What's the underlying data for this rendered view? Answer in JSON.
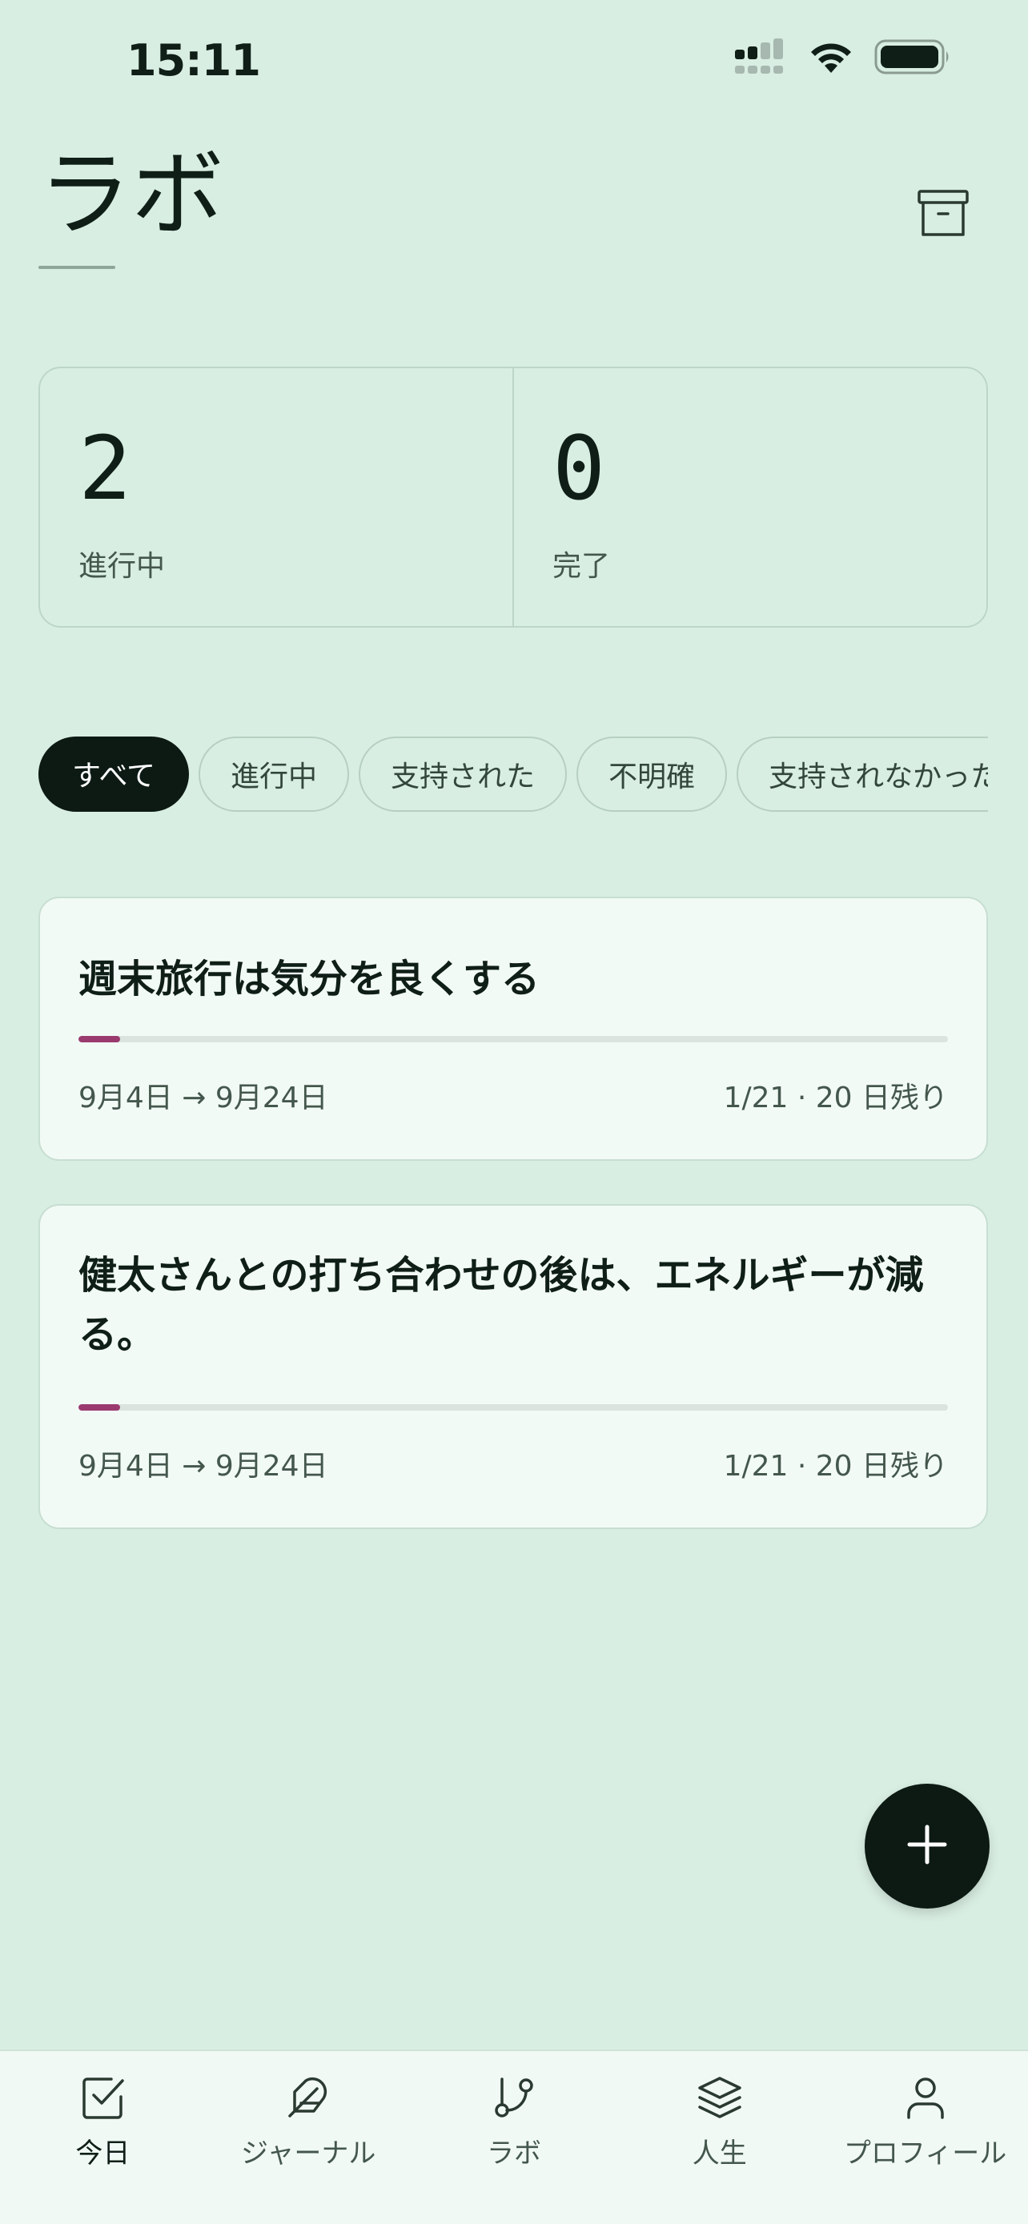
{
  "status_bar": {
    "time": "15:11"
  },
  "header": {
    "title": "ラボ",
    "archive_icon": "archive-box-icon"
  },
  "stats": [
    {
      "value": "2",
      "label": "進行中"
    },
    {
      "value": "0",
      "label": "完了"
    }
  ],
  "filters": {
    "chips": [
      "すべて",
      "進行中",
      "支持された",
      "不明確",
      "支持されなかった"
    ],
    "selected": "すべて"
  },
  "experiments": [
    {
      "title": "週末旅行は気分を良くする",
      "dates": "9月4日 → 9月24日",
      "progress_text": "1/21 · 20 日残り",
      "progress_fraction": 0.0476
    },
    {
      "title": "健太さんとの打ち合わせの後は、エネルギーが減る。",
      "dates": "9月4日 → 9月24日",
      "progress_text": "1/21 · 20 日残り",
      "progress_fraction": 0.0476
    }
  ],
  "fab": {
    "icon": "plus-icon"
  },
  "bottom_nav": [
    {
      "label": "今日",
      "icon": "checkbox-icon"
    },
    {
      "label": "ジャーナル",
      "icon": "feather-icon"
    },
    {
      "label": "ラボ",
      "icon": "git-branch-icon"
    },
    {
      "label": "人生",
      "icon": "layers-icon"
    },
    {
      "label": "プロフィール",
      "icon": "user-icon"
    }
  ],
  "colors": {
    "background": "#d9eee3",
    "card": "#f2faf6",
    "accent": "#9b3a6e",
    "dark": "#0c1a13"
  }
}
